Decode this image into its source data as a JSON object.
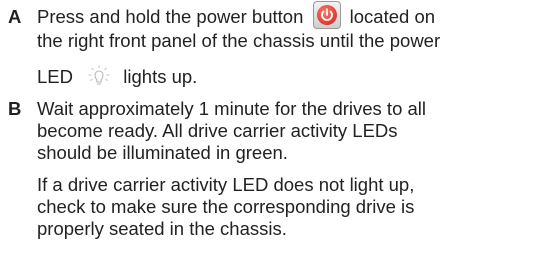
{
  "steps": [
    {
      "marker": "A",
      "line1_before": "Press and hold the power button",
      "line1_after": "located on",
      "line2": "the right front panel of the chassis until the power",
      "line3_before": "LED",
      "line3_after": "lights up.",
      "icons": [
        "power-button-icon",
        "led-icon"
      ]
    },
    {
      "marker": "B",
      "lines": [
        "Wait approximately 1 minute for the drives to all",
        "become ready. All drive carrier activity LEDs",
        "should be illuminated in green."
      ],
      "note_lines": [
        "If a drive carrier activity LED does not light up,",
        "check to make sure the corresponding drive is",
        "properly seated in the chassis."
      ]
    }
  ],
  "colors": {
    "text": "#222222",
    "power_button": "#e0413a"
  }
}
